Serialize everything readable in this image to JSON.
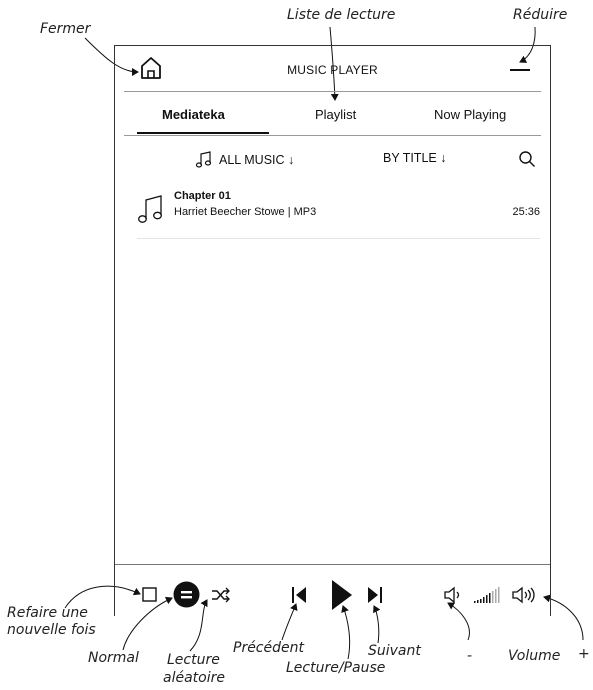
{
  "callouts": {
    "close": "Fermer",
    "playlist": "Liste de lecture",
    "minimize": "Réduire",
    "repeat_line1": "Refaire  une",
    "repeat_line2": "nouvelle fois",
    "normal": "Normal",
    "shuffle_line1": "Lecture",
    "shuffle_line2": "aléatoire",
    "previous": "Précédent",
    "play_pause": "Lecture/Pause",
    "next": "Suivant",
    "volume_minus": "-",
    "volume": "Volume",
    "volume_plus": "+"
  },
  "header": {
    "title": "MUSIC PLAYER"
  },
  "tabs": [
    {
      "label": "Mediateka",
      "active": true
    },
    {
      "label": "Playlist",
      "active": false
    },
    {
      "label": "Now Playing",
      "active": false
    }
  ],
  "filters": {
    "source": "ALL MUSIC ↓",
    "sort": "BY TITLE ↓"
  },
  "tracks": [
    {
      "title": "Chapter 01",
      "meta": "Harriet Beecher Stowe | MP3",
      "duration": "25:36"
    }
  ],
  "icons": {
    "home": "home-icon",
    "minimize": "minimize-icon",
    "music_note": "music-note-icon",
    "search": "search-icon",
    "repeat": "repeat-icon",
    "normal": "normal-mode-icon",
    "shuffle": "shuffle-icon",
    "previous": "previous-icon",
    "play": "play-icon",
    "next": "next-icon",
    "volume_down": "volume-down-icon",
    "volume_up": "volume-up-icon"
  }
}
